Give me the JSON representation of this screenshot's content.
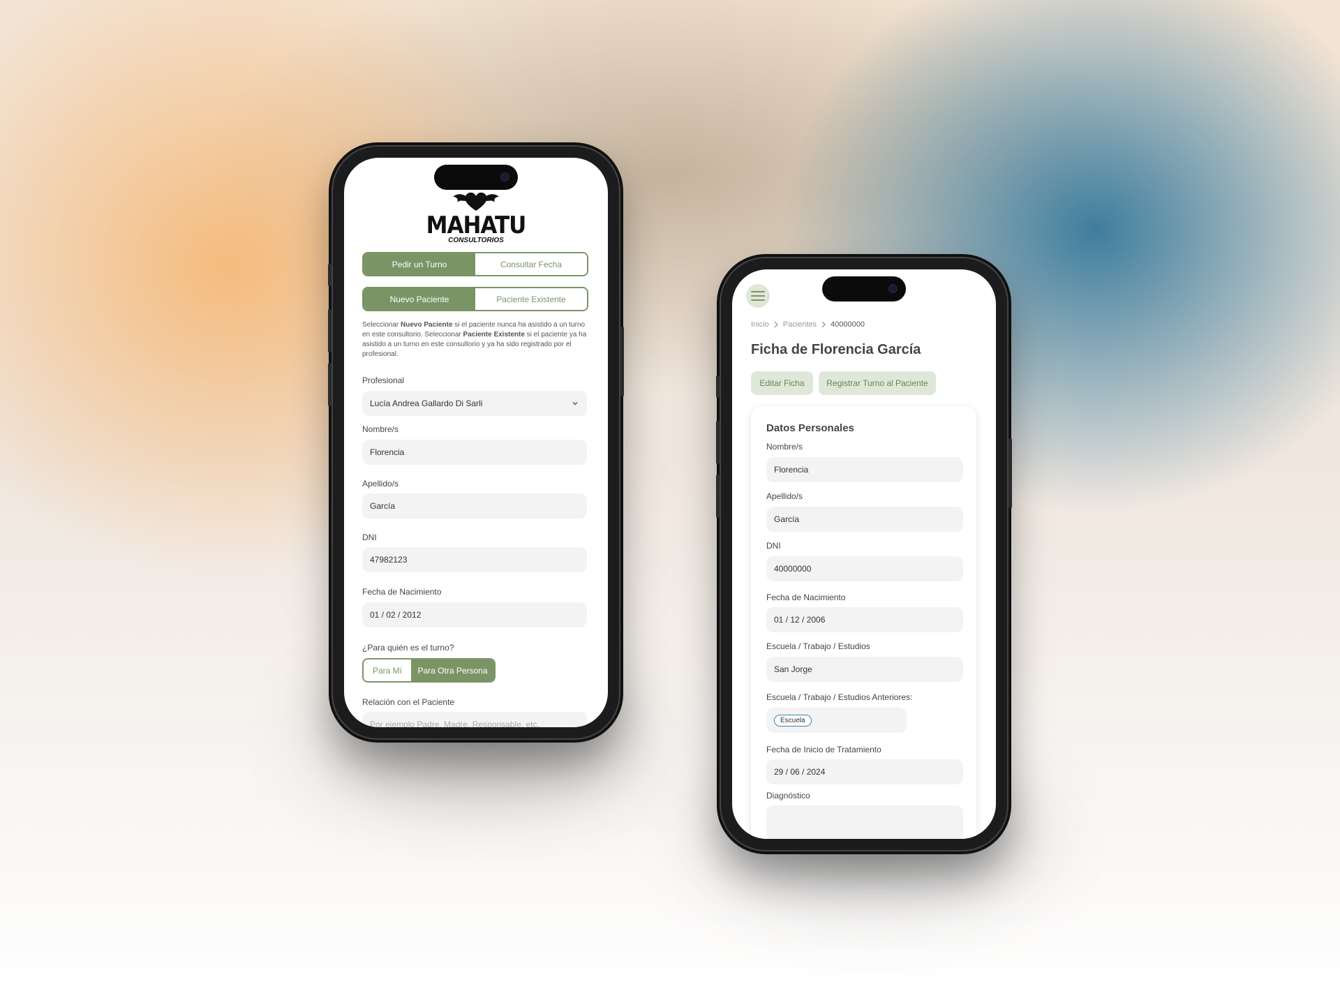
{
  "colors": {
    "accent": "#7a9466",
    "accent_light": "#dfe8d8",
    "field_bg": "#f3f3f3"
  },
  "left_phone": {
    "logo": {
      "name": "MAHATU",
      "subtitle": "CONSULTORIOS",
      "icon": "winged-heart-icon"
    },
    "mode_tabs": {
      "active": "Pedir un Turno",
      "inactive": "Consultar Fecha"
    },
    "patient_tabs": {
      "active": "Nuevo Paciente",
      "inactive": "Paciente Existente"
    },
    "help": {
      "t1": "Seleccionar ",
      "b1": "Nuevo Paciente",
      "t2": " si el paciente nunca ha asistido a un turno en este consultorio. Seleccionar ",
      "b2": "Paciente Existente",
      "t3": " si el paciente ya ha asistido a un turno en este consultorio y ya ha sido registrado por el profesional."
    },
    "profesional": {
      "label": "Profesional",
      "value": "Lucía Andrea Gallardo Di Sarli",
      "icon": "chevron-down-icon"
    },
    "nombre": {
      "label": "Nombre/s",
      "value": "Florencia"
    },
    "apellido": {
      "label": "Apellido/s",
      "value": "García"
    },
    "dni": {
      "label": "DNI",
      "value": "47982123"
    },
    "fecha_nac": {
      "label": "Fecha de Nacimiento",
      "value": "01 / 02 / 2012"
    },
    "para_quien": {
      "label": "¿Para quién es el turno?",
      "option_inactive": "Para Mí",
      "option_active": "Para Otra Persona"
    },
    "relacion": {
      "label": "Relación con el Paciente",
      "placeholder": "Por ejemplo Padre, Madre, Responsable, etc."
    }
  },
  "right_phone": {
    "menu_icon": "hamburger-menu-icon",
    "breadcrumb": {
      "inicio": "Inicio",
      "pacientes": "Pacientes",
      "current": "40000000",
      "separator_icon": "chevron-right-icon"
    },
    "title": "Ficha de Florencia García",
    "buttons": {
      "edit": "Editar Ficha",
      "register": "Registrar Turno al Paciente"
    },
    "card": {
      "heading": "Datos Personales",
      "nombre": {
        "label": "Nombre/s",
        "value": "Florencia"
      },
      "apellido": {
        "label": "Apellido/s",
        "value": "García"
      },
      "dni": {
        "label": "DNI",
        "value": "40000000"
      },
      "fecha_nac": {
        "label": "Fecha de Nacimiento",
        "value": "01 / 12 / 2006"
      },
      "escuela": {
        "label": "Escuela / Trabajo / Estudios",
        "value": "San Jorge"
      },
      "escuela_ant": {
        "label": "Escuela / Trabajo / Estudios Anteriores:",
        "tag": "Escuela"
      },
      "inicio_trat": {
        "label": "Fecha de Inicio de Tratamiento",
        "value": "29 / 06 / 2024"
      },
      "diagnostico": {
        "label": "Diagnóstico",
        "value": ""
      }
    }
  }
}
